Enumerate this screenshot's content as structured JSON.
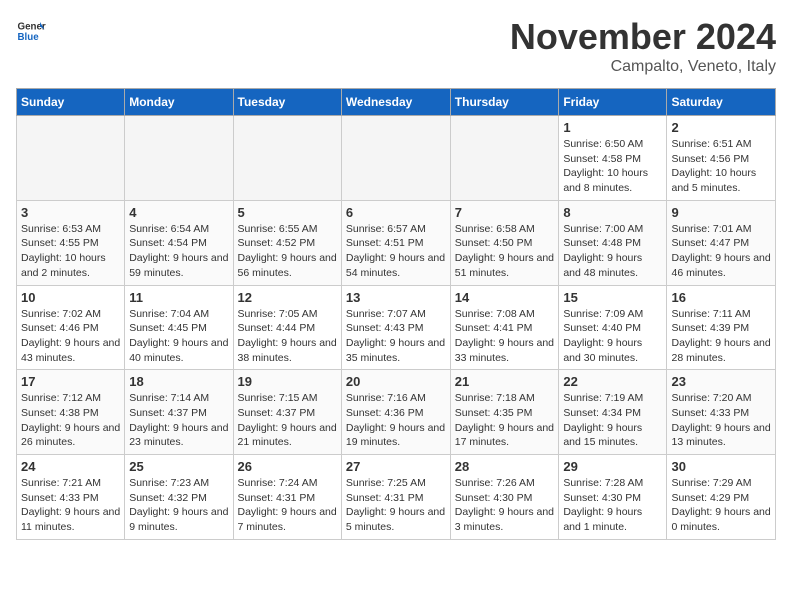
{
  "header": {
    "logo_general": "General",
    "logo_blue": "Blue",
    "month_title": "November 2024",
    "location": "Campalto, Veneto, Italy"
  },
  "weekdays": [
    "Sunday",
    "Monday",
    "Tuesday",
    "Wednesday",
    "Thursday",
    "Friday",
    "Saturday"
  ],
  "weeks": [
    [
      {
        "day": "",
        "info": ""
      },
      {
        "day": "",
        "info": ""
      },
      {
        "day": "",
        "info": ""
      },
      {
        "day": "",
        "info": ""
      },
      {
        "day": "",
        "info": ""
      },
      {
        "day": "1",
        "info": "Sunrise: 6:50 AM\nSunset: 4:58 PM\nDaylight: 10 hours and 8 minutes."
      },
      {
        "day": "2",
        "info": "Sunrise: 6:51 AM\nSunset: 4:56 PM\nDaylight: 10 hours and 5 minutes."
      }
    ],
    [
      {
        "day": "3",
        "info": "Sunrise: 6:53 AM\nSunset: 4:55 PM\nDaylight: 10 hours and 2 minutes."
      },
      {
        "day": "4",
        "info": "Sunrise: 6:54 AM\nSunset: 4:54 PM\nDaylight: 9 hours and 59 minutes."
      },
      {
        "day": "5",
        "info": "Sunrise: 6:55 AM\nSunset: 4:52 PM\nDaylight: 9 hours and 56 minutes."
      },
      {
        "day": "6",
        "info": "Sunrise: 6:57 AM\nSunset: 4:51 PM\nDaylight: 9 hours and 54 minutes."
      },
      {
        "day": "7",
        "info": "Sunrise: 6:58 AM\nSunset: 4:50 PM\nDaylight: 9 hours and 51 minutes."
      },
      {
        "day": "8",
        "info": "Sunrise: 7:00 AM\nSunset: 4:48 PM\nDaylight: 9 hours and 48 minutes."
      },
      {
        "day": "9",
        "info": "Sunrise: 7:01 AM\nSunset: 4:47 PM\nDaylight: 9 hours and 46 minutes."
      }
    ],
    [
      {
        "day": "10",
        "info": "Sunrise: 7:02 AM\nSunset: 4:46 PM\nDaylight: 9 hours and 43 minutes."
      },
      {
        "day": "11",
        "info": "Sunrise: 7:04 AM\nSunset: 4:45 PM\nDaylight: 9 hours and 40 minutes."
      },
      {
        "day": "12",
        "info": "Sunrise: 7:05 AM\nSunset: 4:44 PM\nDaylight: 9 hours and 38 minutes."
      },
      {
        "day": "13",
        "info": "Sunrise: 7:07 AM\nSunset: 4:43 PM\nDaylight: 9 hours and 35 minutes."
      },
      {
        "day": "14",
        "info": "Sunrise: 7:08 AM\nSunset: 4:41 PM\nDaylight: 9 hours and 33 minutes."
      },
      {
        "day": "15",
        "info": "Sunrise: 7:09 AM\nSunset: 4:40 PM\nDaylight: 9 hours and 30 minutes."
      },
      {
        "day": "16",
        "info": "Sunrise: 7:11 AM\nSunset: 4:39 PM\nDaylight: 9 hours and 28 minutes."
      }
    ],
    [
      {
        "day": "17",
        "info": "Sunrise: 7:12 AM\nSunset: 4:38 PM\nDaylight: 9 hours and 26 minutes."
      },
      {
        "day": "18",
        "info": "Sunrise: 7:14 AM\nSunset: 4:37 PM\nDaylight: 9 hours and 23 minutes."
      },
      {
        "day": "19",
        "info": "Sunrise: 7:15 AM\nSunset: 4:37 PM\nDaylight: 9 hours and 21 minutes."
      },
      {
        "day": "20",
        "info": "Sunrise: 7:16 AM\nSunset: 4:36 PM\nDaylight: 9 hours and 19 minutes."
      },
      {
        "day": "21",
        "info": "Sunrise: 7:18 AM\nSunset: 4:35 PM\nDaylight: 9 hours and 17 minutes."
      },
      {
        "day": "22",
        "info": "Sunrise: 7:19 AM\nSunset: 4:34 PM\nDaylight: 9 hours and 15 minutes."
      },
      {
        "day": "23",
        "info": "Sunrise: 7:20 AM\nSunset: 4:33 PM\nDaylight: 9 hours and 13 minutes."
      }
    ],
    [
      {
        "day": "24",
        "info": "Sunrise: 7:21 AM\nSunset: 4:33 PM\nDaylight: 9 hours and 11 minutes."
      },
      {
        "day": "25",
        "info": "Sunrise: 7:23 AM\nSunset: 4:32 PM\nDaylight: 9 hours and 9 minutes."
      },
      {
        "day": "26",
        "info": "Sunrise: 7:24 AM\nSunset: 4:31 PM\nDaylight: 9 hours and 7 minutes."
      },
      {
        "day": "27",
        "info": "Sunrise: 7:25 AM\nSunset: 4:31 PM\nDaylight: 9 hours and 5 minutes."
      },
      {
        "day": "28",
        "info": "Sunrise: 7:26 AM\nSunset: 4:30 PM\nDaylight: 9 hours and 3 minutes."
      },
      {
        "day": "29",
        "info": "Sunrise: 7:28 AM\nSunset: 4:30 PM\nDaylight: 9 hours and 1 minute."
      },
      {
        "day": "30",
        "info": "Sunrise: 7:29 AM\nSunset: 4:29 PM\nDaylight: 9 hours and 0 minutes."
      }
    ]
  ]
}
